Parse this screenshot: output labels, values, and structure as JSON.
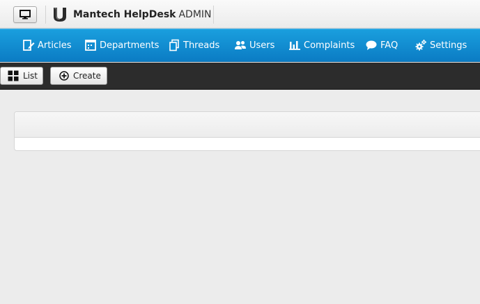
{
  "header": {
    "brand_name": "Mantech HelpDesk",
    "brand_suffix": "ADMIN",
    "toggle_icon": "monitor-icon",
    "logo_icon": "horseshoe-logo"
  },
  "nav": {
    "items": [
      {
        "label": "Articles",
        "icon": "edit-icon"
      },
      {
        "label": "Departments",
        "icon": "calendar-icon"
      },
      {
        "label": "Threads",
        "icon": "copy-icon"
      },
      {
        "label": "Users",
        "icon": "users-icon"
      },
      {
        "label": "Complaints",
        "icon": "bar-chart-icon"
      },
      {
        "label": "FAQ",
        "icon": "chat-icon"
      },
      {
        "label": "Settings",
        "icon": "gears-icon"
      }
    ]
  },
  "toolbar": {
    "list_label": "List",
    "create_label": "Create"
  },
  "colors": {
    "nav_bg": "#0b8fd6",
    "toolbar_bg": "#2c2c2c",
    "page_bg": "#ececec"
  }
}
